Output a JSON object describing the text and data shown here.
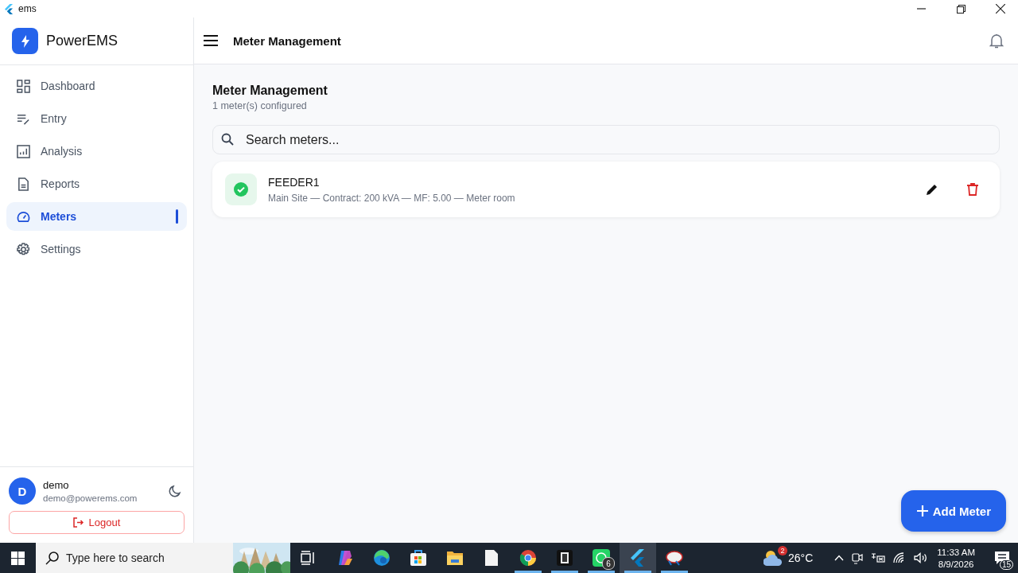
{
  "window": {
    "title": "ems"
  },
  "app": {
    "name": "PowerEMS"
  },
  "nav": [
    {
      "kind": "dashboard",
      "label": "Dashboard",
      "selected": false
    },
    {
      "kind": "entry",
      "label": "Entry",
      "selected": false
    },
    {
      "kind": "analysis",
      "label": "Analysis",
      "selected": false
    },
    {
      "kind": "reports",
      "label": "Reports",
      "selected": false
    },
    {
      "kind": "meters",
      "label": "Meters",
      "selected": true
    },
    {
      "kind": "settings",
      "label": "Settings",
      "selected": false
    }
  ],
  "user": {
    "initial": "D",
    "name": "demo",
    "email": "demo@powerems.com"
  },
  "logout": {
    "label": "Logout"
  },
  "header": {
    "title": "Meter Management"
  },
  "page": {
    "title": "Meter Management",
    "subtitle": "1 meter(s) configured"
  },
  "search": {
    "placeholder": "Search meters..."
  },
  "meters": [
    {
      "name": "FEEDER1",
      "details": "Main Site — Contract: 200 kVA — MF: 5.00 — Meter room",
      "active": true
    }
  ],
  "fab": {
    "label": "Add Meter"
  },
  "taskbar": {
    "search_placeholder": "Type here to search",
    "apps": [
      {
        "kind": "taskview",
        "running": false,
        "selected": false
      },
      {
        "kind": "copilot",
        "running": false,
        "selected": false
      },
      {
        "kind": "edge",
        "running": false,
        "selected": false
      },
      {
        "kind": "store",
        "running": false,
        "selected": false
      },
      {
        "kind": "folder",
        "running": false,
        "selected": false
      },
      {
        "kind": "document",
        "running": false,
        "selected": false
      },
      {
        "kind": "chrome",
        "running": true,
        "selected": false
      },
      {
        "kind": "frame",
        "running": true,
        "selected": false
      },
      {
        "kind": "whatsapp",
        "running": true,
        "selected": false,
        "badge": "6"
      },
      {
        "kind": "flutter",
        "running": true,
        "selected": true
      },
      {
        "kind": "satellite",
        "running": true,
        "selected": false
      }
    ],
    "weather": {
      "temp": "26°C",
      "badge": "2"
    },
    "clock": {
      "time": "11:33 AM",
      "date": "8/9/2026"
    },
    "notifications": {
      "count": "15"
    }
  }
}
